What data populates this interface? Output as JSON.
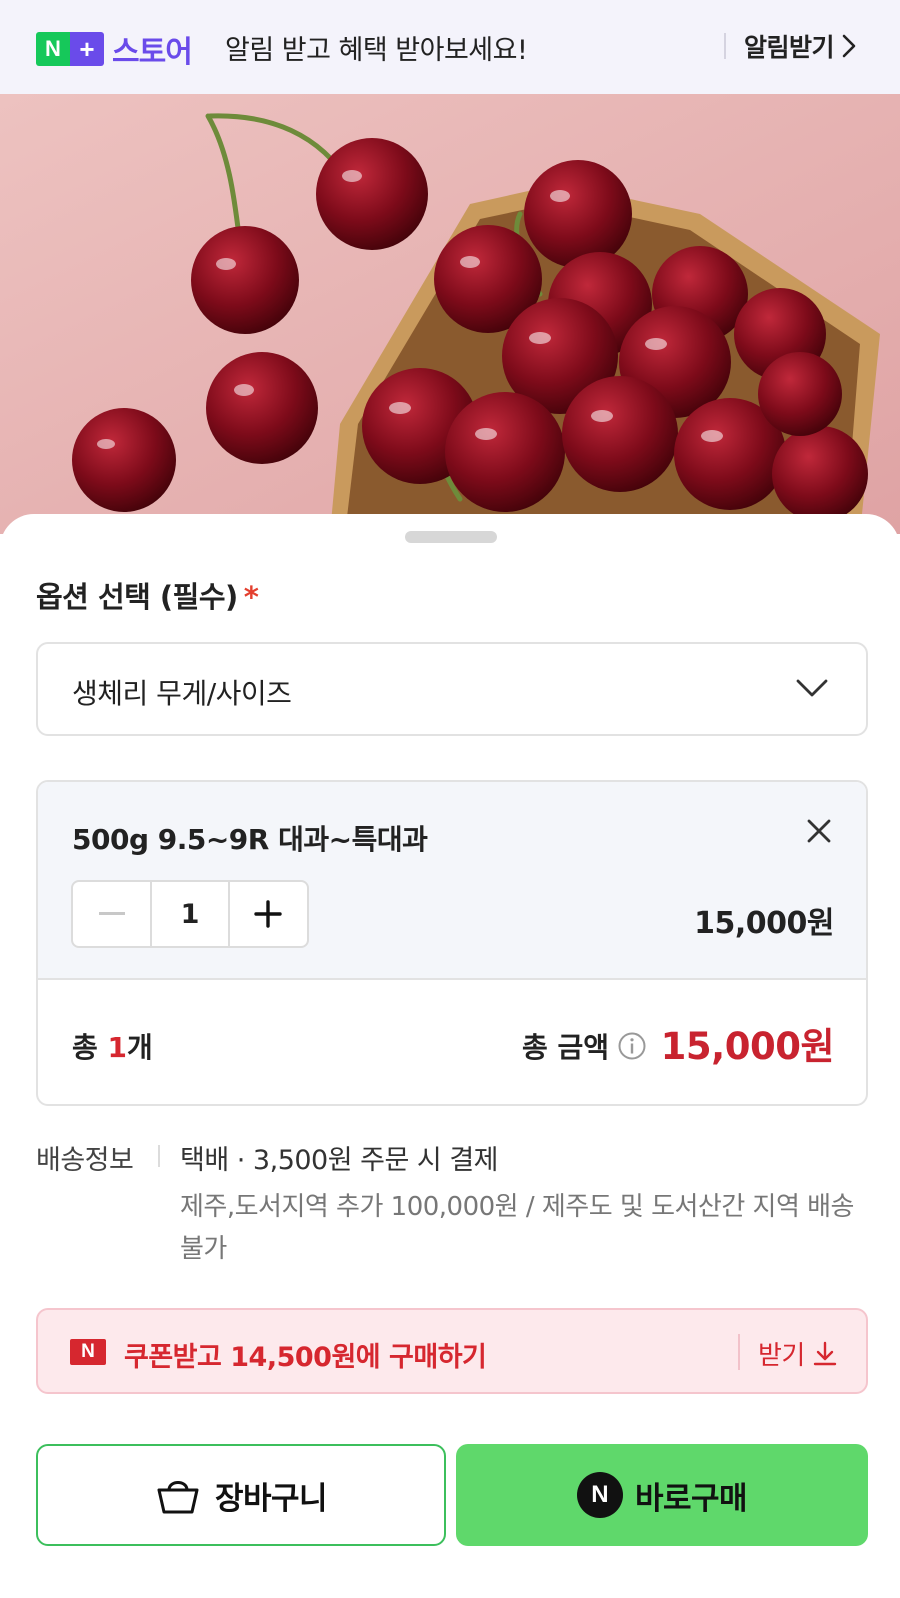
{
  "banner": {
    "logo_n": "N",
    "logo_plus": "+",
    "logo_text": "스토어",
    "message": "알림 받고 혜택 받아보세요!",
    "action_label": "알림받기",
    "action_icon": "chevron-right-icon"
  },
  "hero": {
    "image": "cherries-in-wooden-basket-photo"
  },
  "option": {
    "title": "옵션 선택 (필수)",
    "required_mark": "*",
    "select_value": "생체리 무게/사이즈",
    "select_icon": "chevron-down-icon"
  },
  "selected_item": {
    "name": "500g 9.5~9R 대과~특대과",
    "quantity": "1",
    "price": "15,000원",
    "minus_icon": "minus-icon",
    "plus_icon": "plus-icon",
    "remove_icon": "close-icon"
  },
  "total": {
    "count_prefix": "총 ",
    "count_value": "1",
    "count_suffix": "개",
    "amount_label": "총 금액",
    "amount": "15,000원",
    "info_icon": "info-icon"
  },
  "delivery": {
    "label": "배송정보",
    "main": "택배 · 3,500원 주문 시 결제",
    "note": "제주,도서지역 추가 100,000원 / 제주도 및 도서산간 지역 배송 불가"
  },
  "coupon": {
    "badge": "N",
    "text": "쿠폰받고 14,500원에 구매하기",
    "action_label": "받기",
    "action_icon": "download-icon"
  },
  "buttons": {
    "cart_label": "장바구니",
    "cart_icon": "shopping-basket-icon",
    "buy_badge": "N",
    "buy_label": "바로구매"
  },
  "colors": {
    "brand_green": "#16c85a",
    "brand_purple": "#6a4bea",
    "price_red": "#c8232f",
    "buy_green": "#5fd86b"
  }
}
